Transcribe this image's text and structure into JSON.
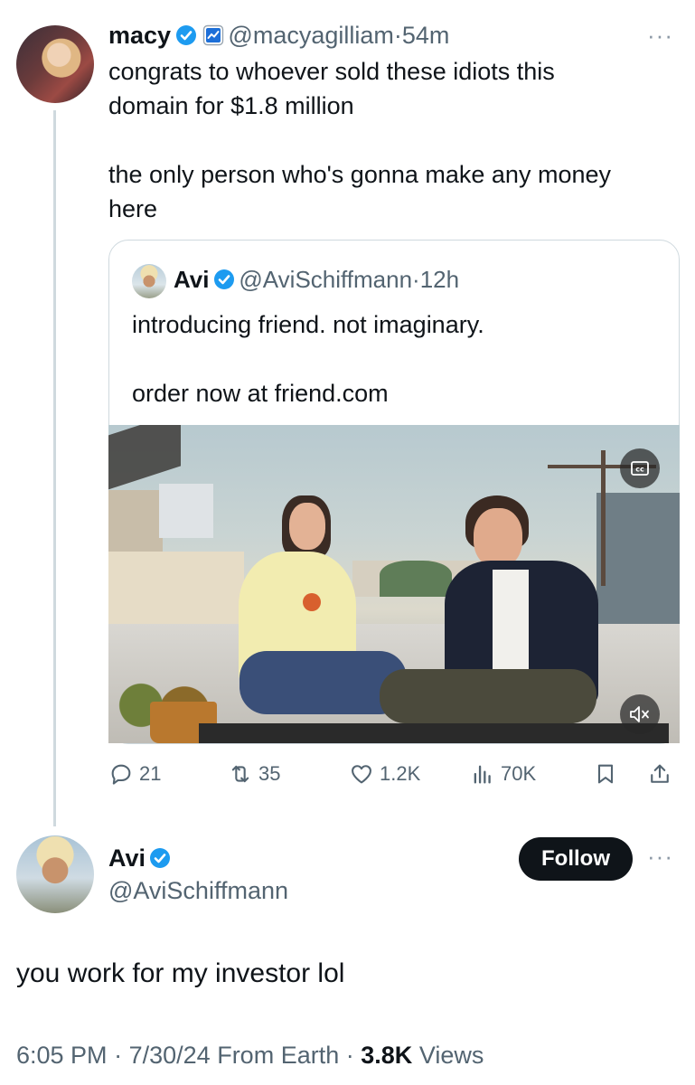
{
  "tweet": {
    "author_name": "macy",
    "author_handle": "@macyagilliam",
    "time": "54m",
    "text_line1": "congrats to whoever sold these idiots this",
    "text_line2": "domain for $1.8 million",
    "text_line3": "the only person who's gonna make any money",
    "text_line4": "here"
  },
  "quote": {
    "author_name": "Avi",
    "author_handle": "@AviSchiffmann",
    "time": "12h",
    "text_line1": "introducing friend. not imaginary.",
    "text_line2": "order now at friend.com"
  },
  "actions": {
    "replies": "21",
    "retweets": "35",
    "likes": "1.2K",
    "views": "70K"
  },
  "reply": {
    "author_name": "Avi",
    "author_handle": "@AviSchiffmann",
    "follow_label": "Follow",
    "text": "you work for my investor lol",
    "time": "6:05 PM",
    "date": "7/30/24",
    "source": "From Earth",
    "views_count": "3.8K",
    "views_label": "Views"
  },
  "more_glyph": "···",
  "separator": "·",
  "colors": {
    "verified_blue": "#1d9bf0",
    "text": "#0f1419",
    "secondary": "#536471",
    "border": "#cfd9de"
  }
}
